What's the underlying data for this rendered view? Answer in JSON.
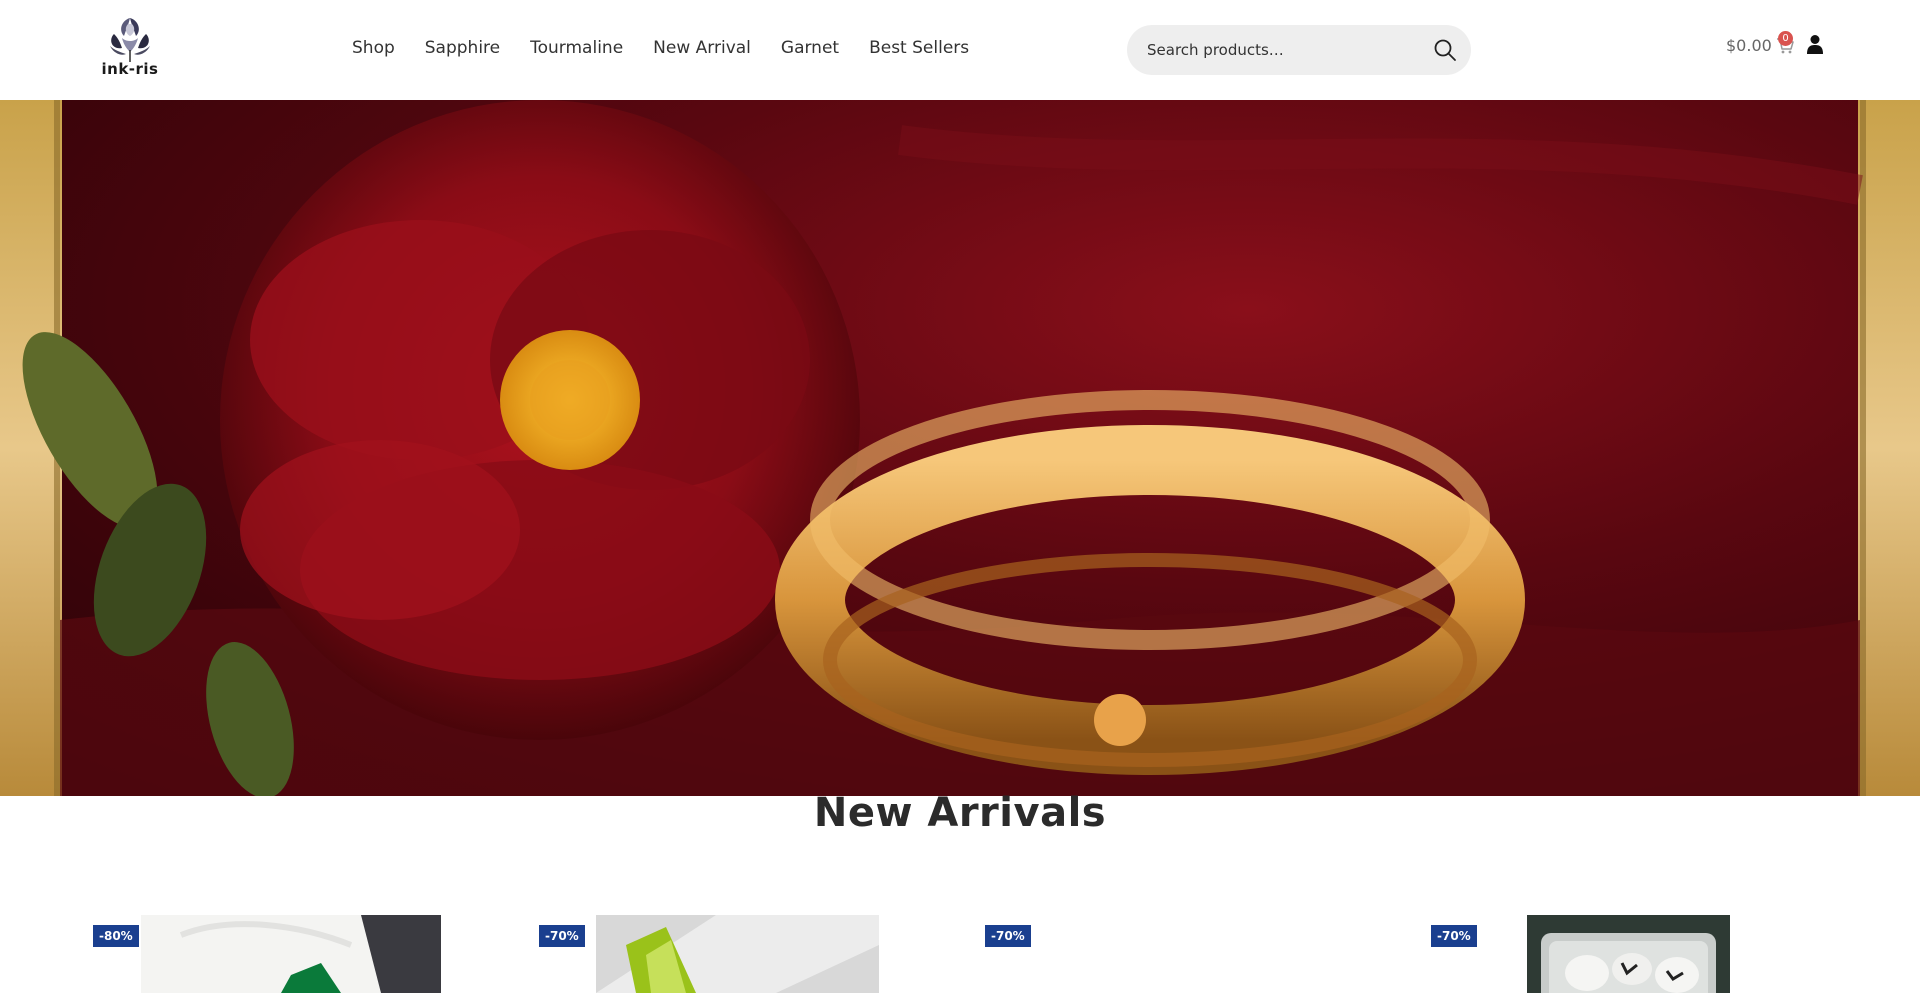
{
  "brand": {
    "name": "ink-ris"
  },
  "nav": {
    "items": [
      {
        "label": "Shop"
      },
      {
        "label": "Sapphire"
      },
      {
        "label": "Tourmaline"
      },
      {
        "label": "New Arrival"
      },
      {
        "label": "Garnet"
      },
      {
        "label": "Best Sellers"
      }
    ]
  },
  "search": {
    "placeholder": "Search products…",
    "icon": "search-icon"
  },
  "cart": {
    "amount": "$0.00",
    "count": "0",
    "icon": "cart-icon"
  },
  "account": {
    "icon": "user-icon"
  },
  "hero": {
    "description_icon": "hero-banner-image"
  },
  "new_arrivals": {
    "title": "New Arrivals",
    "products": [
      {
        "badge": "-80%"
      },
      {
        "badge": "-70%"
      },
      {
        "badge": "-70%"
      },
      {
        "badge": "-70%"
      }
    ]
  },
  "colors": {
    "badge_blue": "#1a3f8f",
    "cart_badge_red": "#d9534f"
  }
}
